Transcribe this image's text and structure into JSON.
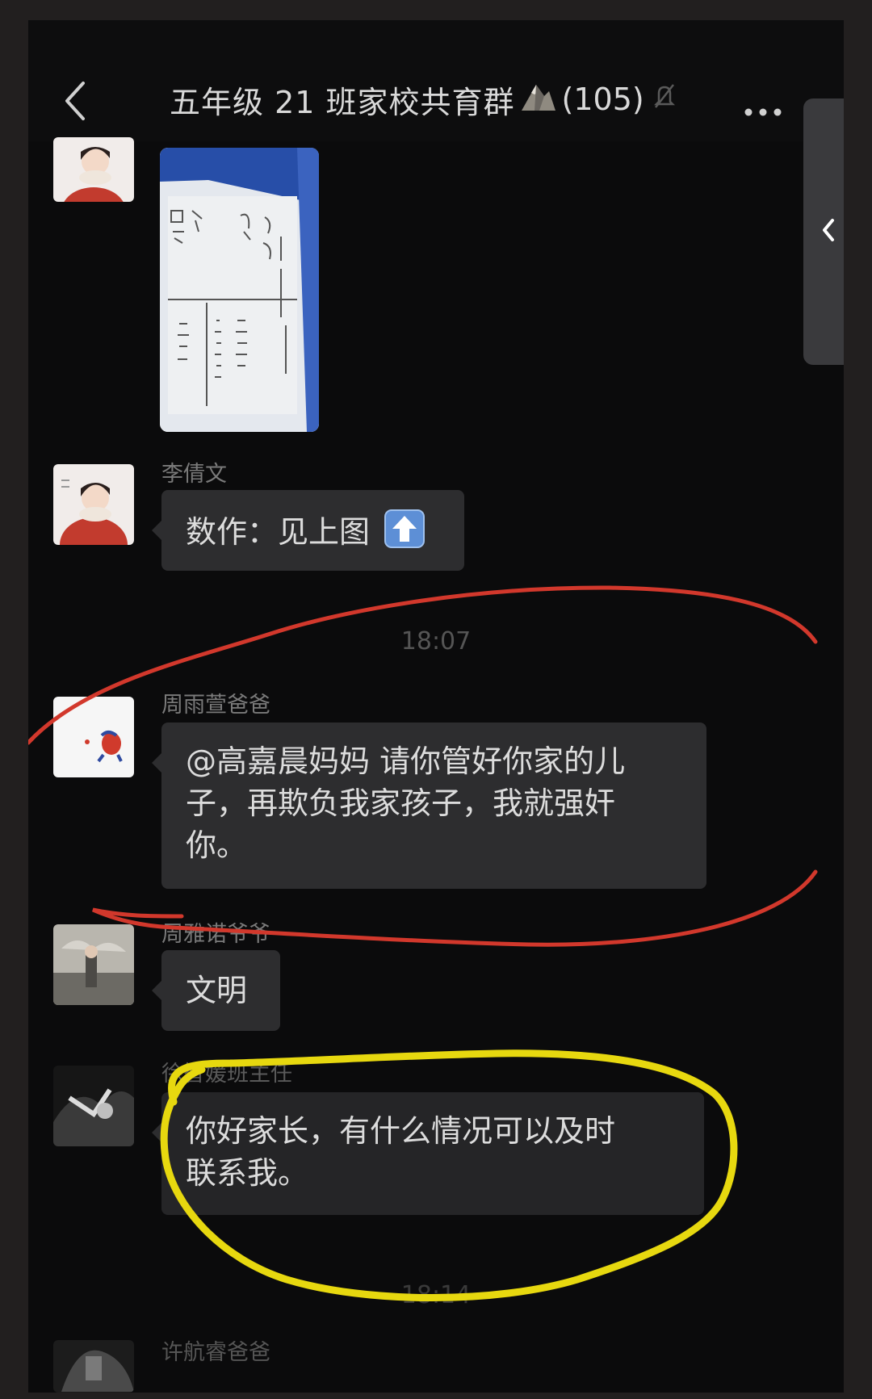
{
  "header": {
    "back_icon": "chevron-left-icon",
    "title": "五年级 21 班家校共育群",
    "member_count": "(105)",
    "mute_icon": "bell-off-icon",
    "more_icon": "more-dots-icon"
  },
  "side_handle": {
    "icon": "chevron-left-icon"
  },
  "messages": [
    {
      "sender": "李倩文",
      "text": "数作：见上图"
    },
    {
      "timestamp": "18:07"
    },
    {
      "sender": "周雨萱爸爸",
      "line1": "@高嘉晨妈妈 请你管好你家的儿",
      "line2": "子，再欺负我家孩子，我就强奸",
      "line3": "你。"
    },
    {
      "sender": "周雅诺爷爷",
      "text": "文明"
    },
    {
      "sender": "徐智媛班主任",
      "line1": "你好家长，有什么情况可以及时",
      "line2": "联系我。"
    },
    {
      "timestamp": "18:14"
    },
    {
      "sender": "许航睿爸爸"
    }
  ],
  "annotations": {
    "red_circle_color": "#d2382c",
    "yellow_circle_color": "#e7d80f"
  }
}
